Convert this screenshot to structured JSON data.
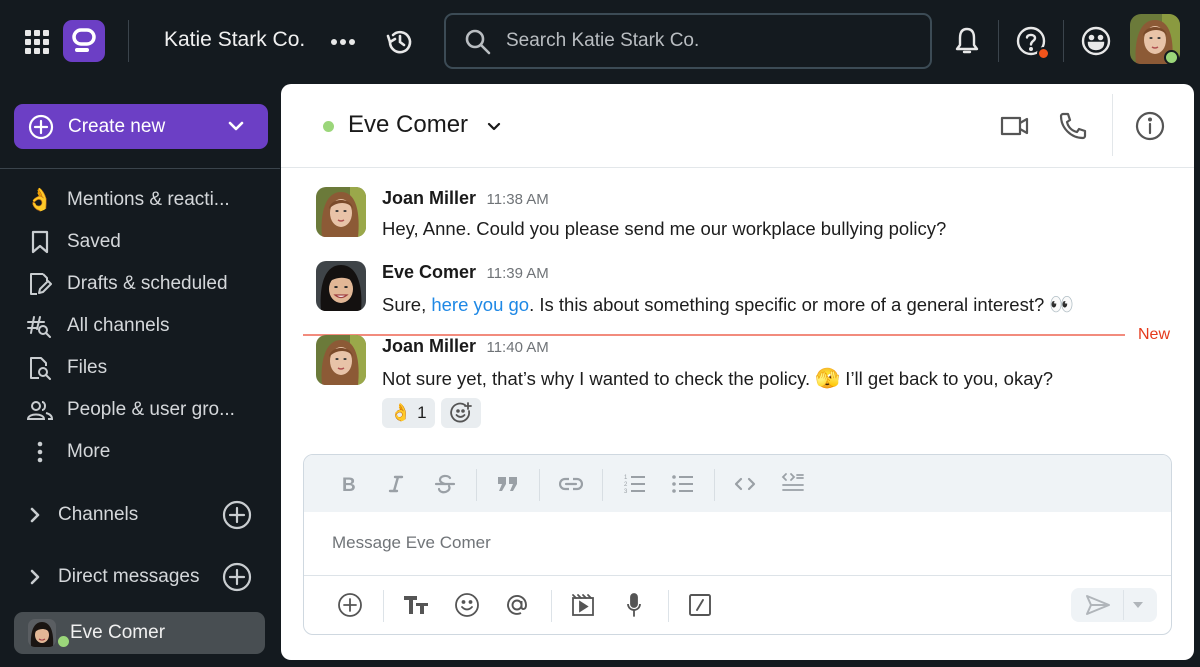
{
  "topbar": {
    "workspace_name": "Katie Stark Co.",
    "search_placeholder": "Search Katie Stark Co.",
    "icons": [
      "apps-grid-icon",
      "app-logo",
      "more-horizontal-icon",
      "history-icon",
      "search-icon",
      "bell-icon",
      "help-icon",
      "emoji-status-icon",
      "user-avatar"
    ],
    "help_notification": true,
    "user_status": "online",
    "colors": {
      "brand": "#6c3fc5",
      "notification": "#f2541b",
      "online": "#9bd67a"
    }
  },
  "sidebar": {
    "create_new_label": "Create new",
    "nav_items": [
      {
        "label": "Mentions & reacti...",
        "icon": "ok-hand-emoji",
        "glyph": "👌"
      },
      {
        "label": "Saved",
        "icon": "bookmark-icon"
      },
      {
        "label": "Drafts & scheduled",
        "icon": "draft-edit-icon"
      },
      {
        "label": "All channels",
        "icon": "channel-search-icon"
      },
      {
        "label": "Files",
        "icon": "file-search-icon"
      },
      {
        "label": "People & user gro...",
        "icon": "people-icon"
      },
      {
        "label": "More",
        "icon": "more-vertical-icon"
      }
    ],
    "sections": [
      {
        "label": "Channels",
        "expanded": false
      },
      {
        "label": "Direct messages",
        "expanded": false
      }
    ],
    "active_dm": {
      "label": "Eve Comer",
      "status": "online"
    }
  },
  "channel": {
    "title": "Eve Comer",
    "status": "online",
    "header_icons": [
      "video-call-icon",
      "phone-call-icon",
      "info-icon"
    ]
  },
  "messages": [
    {
      "author": "Joan Miller",
      "time": "11:38 AM",
      "text": "Hey, Anne. Could you please send me our workplace bullying policy?"
    },
    {
      "author": "Eve Comer",
      "time": "11:39 AM",
      "text_before_link": "Sure, ",
      "link_text": "here you go",
      "text_after_link": ". Is this about something specific or more of a general interest? ",
      "trailing_emoji": "👀"
    },
    {
      "author": "Joan Miller",
      "time": "11:40 AM",
      "text_before_emoji": "Not sure yet, that’s why I wanted to check the policy. ",
      "inline_emoji": "🫣",
      "text_after_emoji": " I’ll get back to you, okay?",
      "reactions": [
        {
          "emoji": "👌",
          "count": "1"
        }
      ]
    }
  ],
  "new_divider_label": "New",
  "composer": {
    "placeholder": "Message Eve Comer",
    "format_tools": [
      "bold",
      "italic",
      "strikethrough",
      "quote",
      "link",
      "ordered-list",
      "bullet-list",
      "code",
      "code-block"
    ],
    "action_tools": [
      "attach",
      "text-format",
      "emoji",
      "mention",
      "video-clip",
      "audio-clip",
      "shortcuts"
    ],
    "send_enabled": false
  }
}
